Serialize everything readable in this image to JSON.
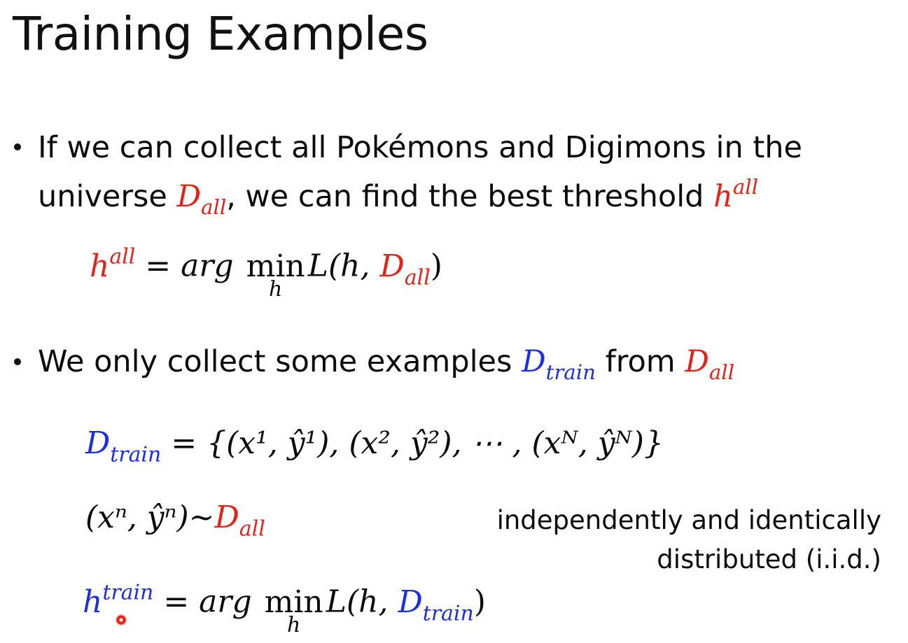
{
  "slide": {
    "title": "Training Examples",
    "bullet1": {
      "line1": "If we can collect all Pokémons and Digimons in the",
      "line2_part1": "universe ",
      "D": "D",
      "all": "all",
      "line2_part2": ", we can find the best threshold ",
      "h": "h"
    },
    "eq1": {
      "lhs_h": "h",
      "lhs_sup": "all",
      "equals": " = ",
      "arg": "arg",
      "min": "min",
      "min_under": "h",
      "L_open": "L(h, ",
      "D": "D",
      "D_sub": "all",
      "close": ")"
    },
    "bullet2": {
      "text1": "We only collect some examples ",
      "D_train": "D",
      "train": "train",
      "text2": " from ",
      "D_all": "D",
      "all": "all"
    },
    "eq2": {
      "D": "D",
      "sub": "train",
      "rhs": " = {(x¹, ŷ¹), (x², ŷ²), ⋯ , (xᴺ, ŷᴺ)}"
    },
    "eq3": {
      "lhs": "(xⁿ, ŷⁿ)~",
      "D": "D",
      "sub": "all"
    },
    "iid_note": {
      "line1": "independently and identically",
      "line2": "distributed (i.i.d.)"
    },
    "eq4": {
      "h": "h",
      "sup": "train",
      "equals": " = ",
      "arg": "arg",
      "min": "min",
      "min_under": "h",
      "L_open": "L(h, ",
      "D": "D",
      "D_sub": "train",
      "close": ")"
    },
    "colors": {
      "all_highlight": "#e2231a",
      "train_highlight": "#1d2ee0",
      "text": "#0c0c0c"
    }
  }
}
